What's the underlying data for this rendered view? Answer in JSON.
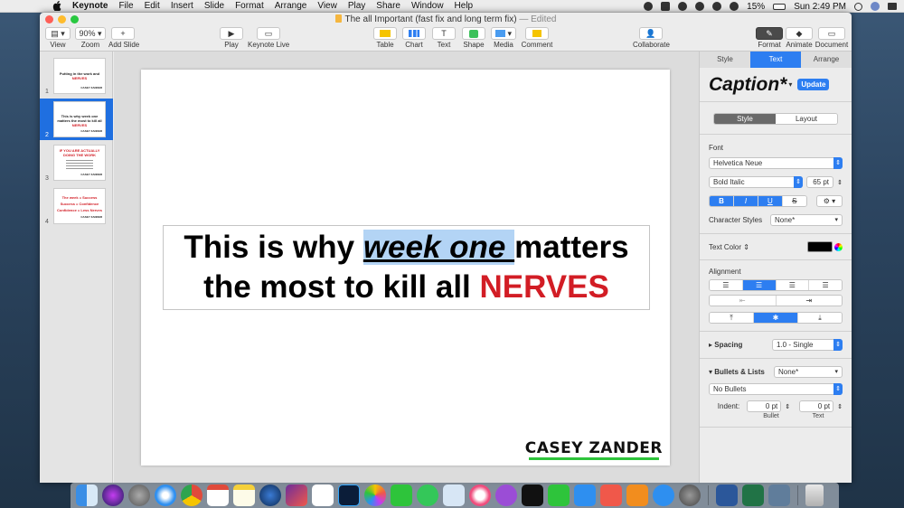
{
  "menubar": {
    "items": [
      "Keynote",
      "File",
      "Edit",
      "Insert",
      "Slide",
      "Format",
      "Arrange",
      "View",
      "Play",
      "Share",
      "Window",
      "Help"
    ],
    "battery": "15%",
    "clock": "Sun 2:49 PM"
  },
  "window": {
    "title": "The all Important (fast fix and long term fix)",
    "edited": "— Edited",
    "colors": {
      "close": "#fe5f57",
      "minimize": "#febc2e",
      "zoom": "#28c840"
    }
  },
  "toolbar": {
    "view": "View",
    "zoom_value": "90%",
    "zoom": "Zoom",
    "add_slide": "Add Slide",
    "play": "Play",
    "keynote_live": "Keynote Live",
    "table": "Table",
    "chart": "Chart",
    "text": "Text",
    "shape": "Shape",
    "media": "Media",
    "comment": "Comment",
    "collaborate": "Collaborate",
    "format": "Format",
    "animate": "Animate",
    "document": "Document"
  },
  "navigator": {
    "slides": [
      {
        "num": "1",
        "line1": "Putting in the work and",
        "red": "NERVES",
        "footer": "CASEY ZANDER"
      },
      {
        "num": "2",
        "line1": "This is why week one matters the most to kill all",
        "red": "NERVES",
        "footer": "CASEY ZANDER"
      },
      {
        "num": "3",
        "line1": "",
        "red": "IF YOU ARE ACTUALLY DOING THE WORK",
        "footer": "CASEY ZANDER"
      },
      {
        "num": "4",
        "line1": "",
        "red": "The week = Success  Success = Confidence  Confidence = Less Nerves",
        "footer": "CASEY ZANDER"
      }
    ]
  },
  "slide": {
    "line1_a": "This is why ",
    "line1_highlight": "week one ",
    "line1_b": "matters",
    "line2_a": "the most to kill all ",
    "line2_red": "NERVES",
    "logo": "CASEY ZANDER",
    "accent_red": "#d21d25",
    "logo_bar": "#2ec43b"
  },
  "inspector": {
    "tabs": [
      "Style",
      "Text",
      "Arrange"
    ],
    "active_tab": "Text",
    "paragraph_style": "Caption*",
    "update": "Update",
    "segment": [
      "Style",
      "Layout"
    ],
    "font_label": "Font",
    "font_family": "Helvetica Neue",
    "font_typeface": "Bold Italic",
    "font_size": "65 pt",
    "bold": "B",
    "italic": "I",
    "underline": "U",
    "strike": "S",
    "char_styles_label": "Character Styles",
    "char_styles_value": "None*",
    "text_color_label": "Text Color",
    "alignment_label": "Alignment",
    "spacing_label": "Spacing",
    "spacing_value": "1.0 - Single",
    "bullets_label": "Bullets & Lists",
    "bullets_value": "None*",
    "bullets_type": "No Bullets",
    "indent_label": "Indent:",
    "indent_bullet": "0 pt",
    "indent_text": "0 pt",
    "bullet_sub": "Bullet",
    "text_sub": "Text",
    "accent": "#2d7ef1"
  }
}
